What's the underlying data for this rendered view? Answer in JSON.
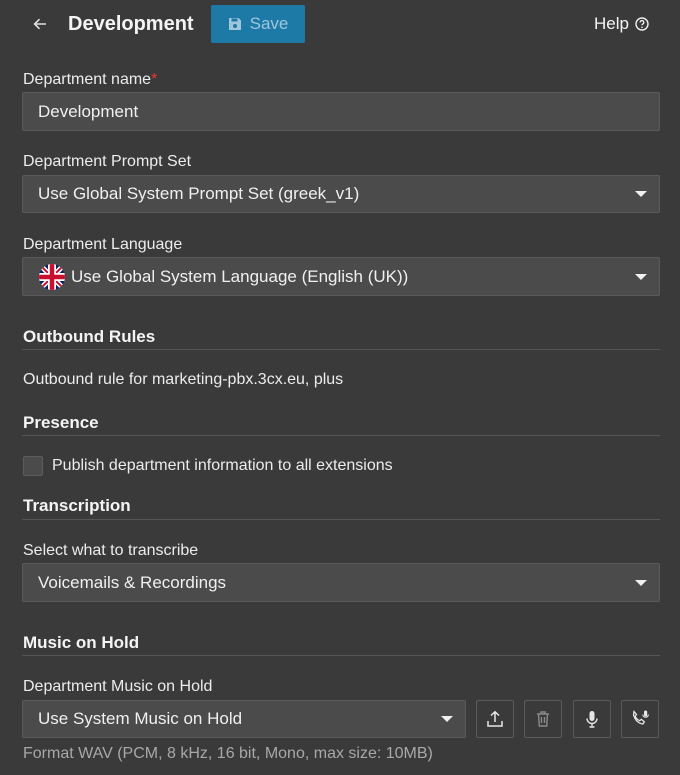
{
  "header": {
    "title": "Development",
    "save_label": "Save",
    "help_label": "Help"
  },
  "department_name": {
    "label": "Department name",
    "required_mark": "*",
    "value": "Development"
  },
  "prompt_set": {
    "label": "Department Prompt Set",
    "selected": "Use Global System Prompt Set (greek_v1)"
  },
  "language": {
    "label": "Department Language",
    "selected": "Use Global System Language (English (UK))",
    "flag_icon": "uk-flag-icon"
  },
  "outbound": {
    "title": "Outbound Rules",
    "text": "Outbound rule for marketing-pbx.3cx.eu, plus"
  },
  "presence": {
    "title": "Presence",
    "checkbox_label": "Publish department information to all extensions",
    "checked": false
  },
  "transcription": {
    "title": "Transcription",
    "label": "Select what to transcribe",
    "selected": "Voicemails & Recordings"
  },
  "music_on_hold": {
    "title": "Music on Hold",
    "label": "Department Music on Hold",
    "selected": "Use System Music on Hold",
    "buttons": [
      "upload-icon",
      "trash-icon",
      "microphone-icon",
      "phone-record-icon"
    ],
    "hint": "Format WAV (PCM, 8 kHz, 16 bit, Mono, max size: 10MB)"
  },
  "colors": {
    "background": "#3a3a3a",
    "field": "#4b4b4b",
    "accent": "#1d7aa6",
    "required": "#e53935"
  }
}
